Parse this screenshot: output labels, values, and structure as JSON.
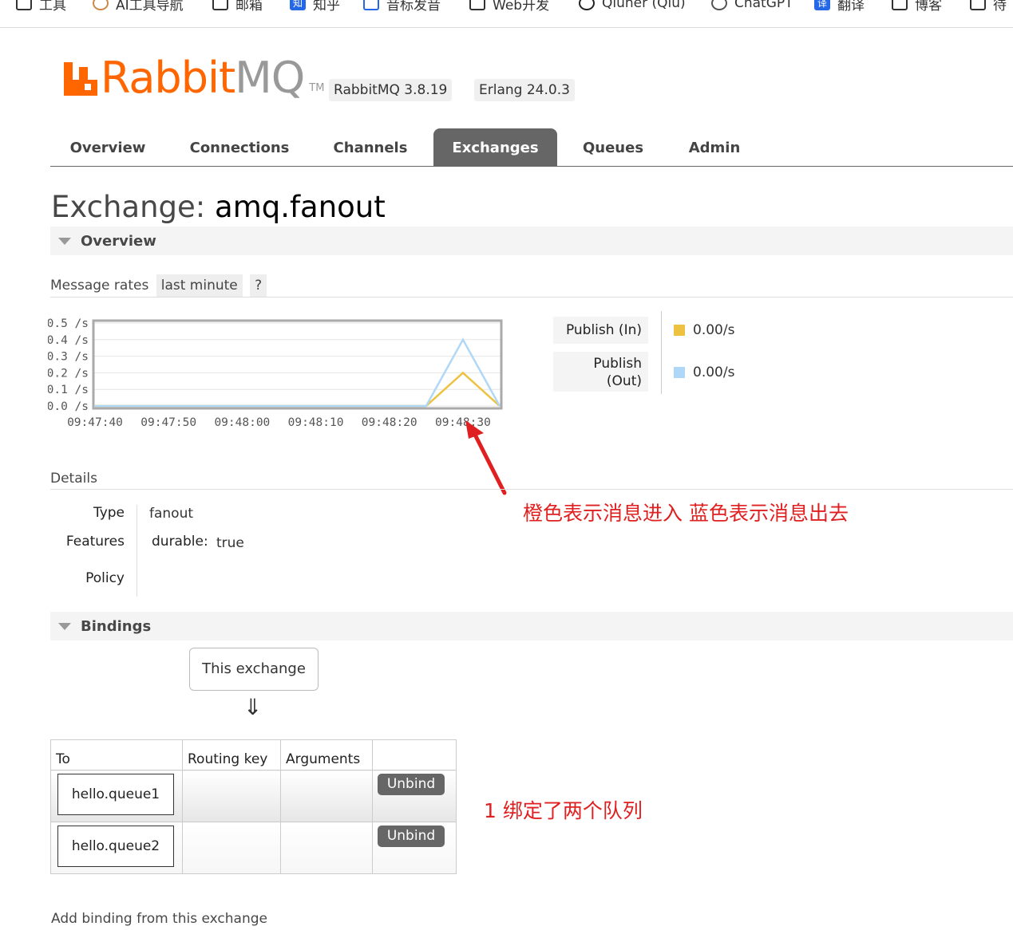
{
  "bookmarks": [
    {
      "label": "工具",
      "icon": "folder-icon"
    },
    {
      "label": "AI工具导航",
      "icon": "site-icon"
    },
    {
      "label": "邮箱",
      "icon": "folder-icon"
    },
    {
      "label": "知乎",
      "icon": "zhihu-icon"
    },
    {
      "label": "音标发音",
      "icon": "robot-icon"
    },
    {
      "label": "Web开发",
      "icon": "folder-icon"
    },
    {
      "label": "Qiuner (Qiu)",
      "icon": "github-icon"
    },
    {
      "label": "ChatGPT",
      "icon": "openai-icon"
    },
    {
      "label": "翻译",
      "icon": "translate-icon"
    },
    {
      "label": "博客",
      "icon": "folder-icon"
    },
    {
      "label": "待",
      "icon": "folder-icon"
    }
  ],
  "logo": {
    "rabbit": "Rabbit",
    "mq": "MQ",
    "tm": "TM"
  },
  "versions": {
    "rabbitmq": "RabbitMQ 3.8.19",
    "erlang": "Erlang 24.0.3"
  },
  "nav": {
    "tabs": [
      "Overview",
      "Connections",
      "Channels",
      "Exchanges",
      "Queues",
      "Admin"
    ],
    "active": "Exchanges"
  },
  "page": {
    "title_prefix": "Exchange:",
    "exchange_name": "amq.fanout"
  },
  "overview": {
    "section_label": "Overview",
    "message_rates_label": "Message rates",
    "range": "last minute",
    "help": "?"
  },
  "chart_data": {
    "type": "line",
    "x": [
      "09:47:40",
      "09:47:45",
      "09:47:50",
      "09:47:55",
      "09:48:00",
      "09:48:05",
      "09:48:10",
      "09:48:15",
      "09:48:20",
      "09:48:25",
      "09:48:30",
      "09:48:35"
    ],
    "series": [
      {
        "name": "Publish (In)",
        "color": "#edc240",
        "values": [
          0,
          0,
          0,
          0,
          0,
          0,
          0,
          0,
          0,
          0,
          0.2,
          0
        ]
      },
      {
        "name": "Publish (Out)",
        "color": "#afd8f8",
        "values": [
          0,
          0,
          0,
          0,
          0,
          0,
          0,
          0,
          0,
          0,
          0.4,
          0
        ]
      }
    ],
    "x_tick_labels": [
      "09:47:40",
      "09:47:50",
      "09:48:00",
      "09:48:10",
      "09:48:20",
      "09:48:30"
    ],
    "y_tick_labels": [
      "0.5 /s",
      "0.4 /s",
      "0.3 /s",
      "0.2 /s",
      "0.1 /s",
      "0.0 /s"
    ],
    "ylim": [
      0,
      0.5
    ],
    "grid": true
  },
  "legend": [
    {
      "label": "Publish (In)",
      "value": "0.00/s",
      "color": "#edc240"
    },
    {
      "label": "Publish (Out)",
      "value": "0.00/s",
      "color": "#afd8f8"
    }
  ],
  "details": {
    "label": "Details",
    "type_key": "Type",
    "type_value": "fanout",
    "features_key": "Features",
    "feature_name": "durable:",
    "feature_value": "true",
    "policy_key": "Policy"
  },
  "annotations": {
    "colors_note": "橙色表示消息进入 蓝色表示消息出去",
    "bindings_note": "1 绑定了两个队列"
  },
  "bindings": {
    "section_label": "Bindings",
    "this_exchange": "This exchange",
    "arrow": "⇓",
    "columns": [
      "To",
      "Routing key",
      "Arguments",
      ""
    ],
    "rows": [
      {
        "to": "hello.queue1",
        "routing_key": "",
        "arguments": "",
        "action": "Unbind"
      },
      {
        "to": "hello.queue2",
        "routing_key": "",
        "arguments": "",
        "action": "Unbind"
      }
    ],
    "add_binding_label": "Add binding from this exchange"
  }
}
